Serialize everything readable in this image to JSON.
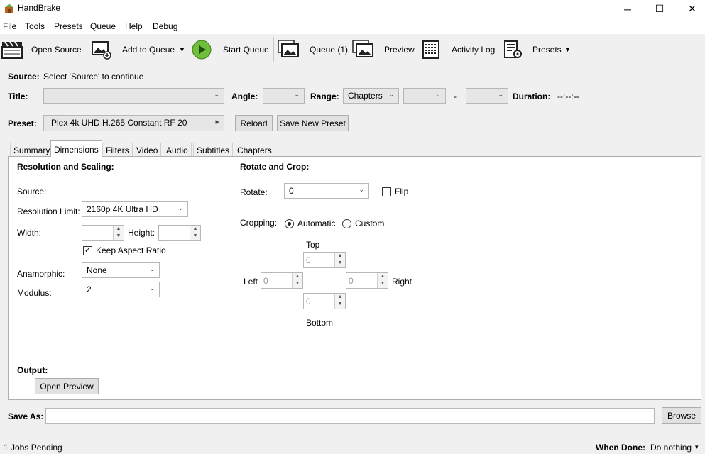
{
  "window": {
    "title": "HandBrake",
    "controls": {
      "minimize": "─",
      "maximize": "☐",
      "close": "✕"
    }
  },
  "menu": [
    "File",
    "Tools",
    "Presets",
    "Queue",
    "Help",
    "Debug"
  ],
  "toolbar": {
    "open_source": "Open Source",
    "add_to_queue": "Add to Queue",
    "start_queue": "Start Queue",
    "queue": "Queue (1)",
    "preview": "Preview",
    "activity_log": "Activity Log",
    "presets": "Presets",
    "caret": "▼"
  },
  "source": {
    "label": "Source:",
    "value": "Select 'Source' to continue"
  },
  "title_row": {
    "title_label": "Title:",
    "angle_label": "Angle:",
    "range_label": "Range:",
    "range_value": "Chapters",
    "range_sep": "-",
    "duration_label": "Duration:",
    "duration_value": "--:--:--",
    "chev": "⌄"
  },
  "preset": {
    "label": "Preset:",
    "value": "Plex 4k UHD H.265 Constant RF 20",
    "arrow": "▸",
    "reload": "Reload",
    "save_new": "Save New Preset"
  },
  "tabs": [
    "Summary",
    "Dimensions",
    "Filters",
    "Video",
    "Audio",
    "Subtitles",
    "Chapters"
  ],
  "dimensions": {
    "resolution_heading": "Resolution and Scaling:",
    "source_label": "Source:",
    "resolution_limit_label": "Resolution Limit:",
    "resolution_limit_value": "2160p 4K Ultra HD",
    "width_label": "Width:",
    "height_label": "Height:",
    "keep_aspect_label": "Keep Aspect Ratio",
    "check_mark": "✓",
    "anamorphic_label": "Anamorphic:",
    "anamorphic_value": "None",
    "modulus_label": "Modulus:",
    "modulus_value": "2",
    "rotate_heading": "Rotate and Crop:",
    "rotate_label": "Rotate:",
    "rotate_value": "0",
    "flip_label": "Flip",
    "cropping_label": "Cropping:",
    "crop_automatic": "Automatic",
    "crop_custom": "Custom",
    "top_label": "Top",
    "left_label": "Left",
    "right_label": "Right",
    "bottom_label": "Bottom",
    "crop_top": "0",
    "crop_left": "0",
    "crop_right": "0",
    "crop_bottom": "0",
    "output_heading": "Output:",
    "open_preview": "Open Preview",
    "spin_up": "▲",
    "spin_down": "▼"
  },
  "save_as": {
    "label": "Save As:",
    "value": "",
    "browse": "Browse"
  },
  "status": {
    "jobs_pending": "1 Jobs Pending",
    "when_done_label": "When Done:",
    "when_done_value": "Do nothing",
    "caret": "▾"
  }
}
